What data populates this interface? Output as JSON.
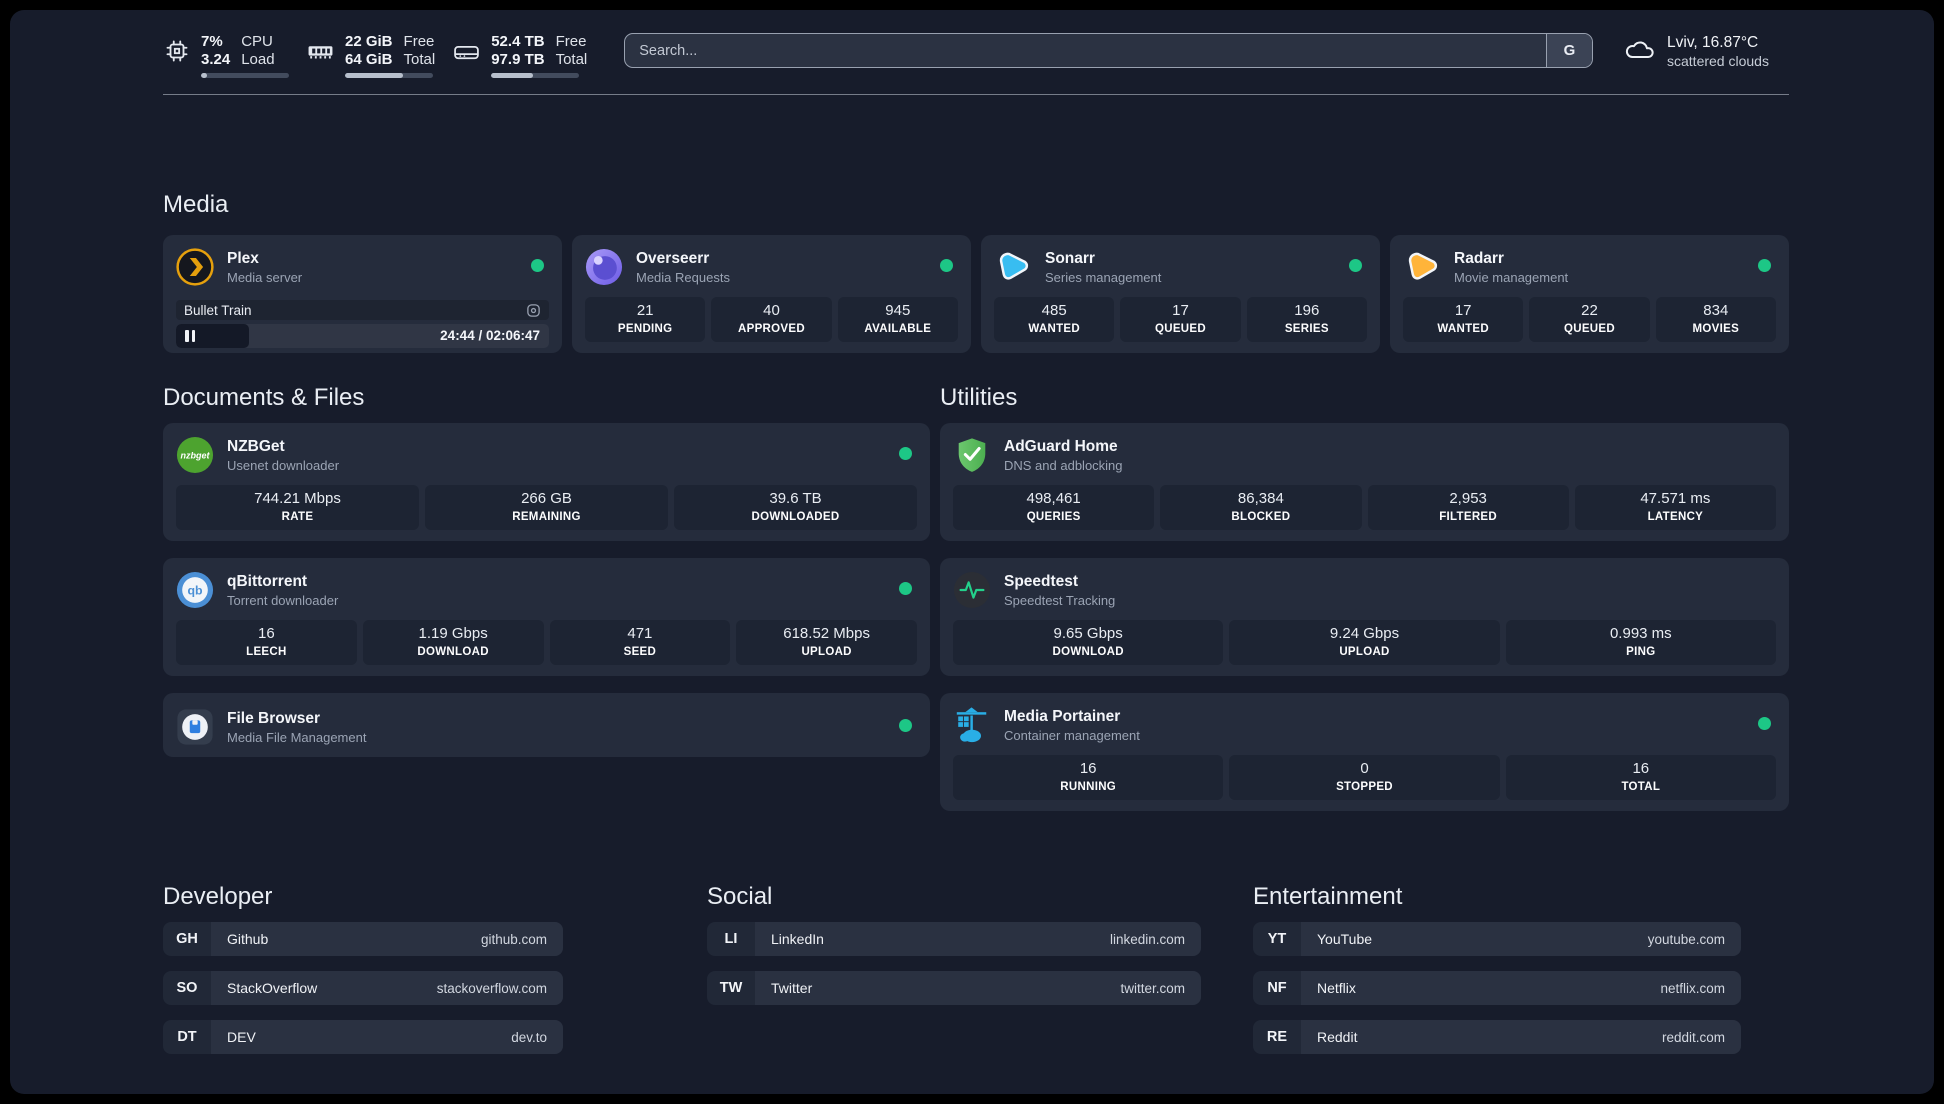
{
  "header": {
    "stats": [
      {
        "name": "cpu",
        "top_value": "7%",
        "bottom_value": "3.24",
        "top_label": "CPU",
        "bottom_label": "Load",
        "progress_pct": 7
      },
      {
        "name": "memory",
        "top_value": "22 GiB",
        "bottom_value": "64 GiB",
        "top_label": "Free",
        "bottom_label": "Total",
        "progress_pct": 66
      },
      {
        "name": "storage",
        "top_value": "52.4 TB",
        "bottom_value": "97.9 TB",
        "top_label": "Free",
        "bottom_label": "Total",
        "progress_pct": 47
      }
    ],
    "search_placeholder": "Search...",
    "search_provider": "G",
    "weather": {
      "location_temp": "Lviv, 16.87°C",
      "condition": "scattered clouds"
    }
  },
  "sections": {
    "media": {
      "title": "Media",
      "plex": {
        "name": "Plex",
        "description": "Media server",
        "online": true,
        "media_title": "Bullet Train",
        "media_time": "24:44 / 02:06:47",
        "progress_pct": 19.5
      },
      "overseerr": {
        "name": "Overseerr",
        "description": "Media Requests",
        "online": true,
        "stats": [
          {
            "value": "21",
            "label": "PENDING"
          },
          {
            "value": "40",
            "label": "APPROVED"
          },
          {
            "value": "945",
            "label": "AVAILABLE"
          }
        ]
      },
      "sonarr": {
        "name": "Sonarr",
        "description": "Series management",
        "online": true,
        "stats": [
          {
            "value": "485",
            "label": "WANTED"
          },
          {
            "value": "17",
            "label": "QUEUED"
          },
          {
            "value": "196",
            "label": "SERIES"
          }
        ]
      },
      "radarr": {
        "name": "Radarr",
        "description": "Movie management",
        "online": true,
        "stats": [
          {
            "value": "17",
            "label": "WANTED"
          },
          {
            "value": "22",
            "label": "QUEUED"
          },
          {
            "value": "834",
            "label": "MOVIES"
          }
        ]
      }
    },
    "documents": {
      "title": "Documents & Files",
      "nzbget": {
        "name": "NZBGet",
        "description": "Usenet downloader",
        "online": true,
        "stats": [
          {
            "value": "744.21 Mbps",
            "label": "RATE"
          },
          {
            "value": "266 GB",
            "label": "REMAINING"
          },
          {
            "value": "39.6 TB",
            "label": "DOWNLOADED"
          }
        ]
      },
      "qbittorrent": {
        "name": "qBittorrent",
        "description": "Torrent downloader",
        "online": true,
        "stats": [
          {
            "value": "16",
            "label": "LEECH"
          },
          {
            "value": "1.19 Gbps",
            "label": "DOWNLOAD"
          },
          {
            "value": "471",
            "label": "SEED"
          },
          {
            "value": "618.52 Mbps",
            "label": "UPLOAD"
          }
        ]
      },
      "filebrowser": {
        "name": "File Browser",
        "description": "Media File Management",
        "online": true
      }
    },
    "utilities": {
      "title": "Utilities",
      "adguard": {
        "name": "AdGuard Home",
        "description": "DNS and adblocking",
        "stats": [
          {
            "value": "498,461",
            "label": "QUERIES"
          },
          {
            "value": "86,384",
            "label": "BLOCKED"
          },
          {
            "value": "2,953",
            "label": "FILTERED"
          },
          {
            "value": "47.571 ms",
            "label": "LATENCY"
          }
        ]
      },
      "speedtest": {
        "name": "Speedtest",
        "description": "Speedtest Tracking",
        "stats": [
          {
            "value": "9.65 Gbps",
            "label": "DOWNLOAD"
          },
          {
            "value": "9.24 Gbps",
            "label": "UPLOAD"
          },
          {
            "value": "0.993 ms",
            "label": "PING"
          }
        ]
      },
      "portainer": {
        "name": "Media Portainer",
        "description": "Container management",
        "online": true,
        "stats": [
          {
            "value": "16",
            "label": "RUNNING"
          },
          {
            "value": "0",
            "label": "STOPPED"
          },
          {
            "value": "16",
            "label": "TOTAL"
          }
        ]
      }
    },
    "bookmarks": [
      {
        "title": "Developer",
        "links": [
          {
            "tag": "GH",
            "name": "Github",
            "url": "github.com"
          },
          {
            "tag": "SO",
            "name": "StackOverflow",
            "url": "stackoverflow.com"
          },
          {
            "tag": "DT",
            "name": "DEV",
            "url": "dev.to"
          }
        ]
      },
      {
        "title": "Social",
        "links": [
          {
            "tag": "LI",
            "name": "LinkedIn",
            "url": "linkedin.com"
          },
          {
            "tag": "TW",
            "name": "Twitter",
            "url": "twitter.com"
          }
        ]
      },
      {
        "title": "Entertainment",
        "links": [
          {
            "tag": "YT",
            "name": "YouTube",
            "url": "youtube.com"
          },
          {
            "tag": "NF",
            "name": "Netflix",
            "url": "netflix.com"
          },
          {
            "tag": "RE",
            "name": "Reddit",
            "url": "reddit.com"
          }
        ]
      }
    ]
  },
  "icons": {
    "header": [
      "cpu-icon",
      "memory-icon",
      "disk-icon",
      "cloud-icon"
    ],
    "apps": [
      "plex-icon",
      "overseerr-icon",
      "sonarr-icon",
      "radarr-icon",
      "nzbget-icon",
      "qbittorrent-icon",
      "filebrowser-icon",
      "adguard-icon",
      "speedtest-icon",
      "portainer-icon"
    ],
    "controls": [
      "pause-icon",
      "settings-icon",
      "search-provider-g"
    ]
  },
  "colors": {
    "background": "#171c2b",
    "card": "#252c3c",
    "stat_box": "#1d2433",
    "status_online_green": "#1dc786",
    "plex_amber": "#e5a00d",
    "sonarr_blue": "#38bdf1",
    "radarr_amber": "#ffb43a",
    "adguard_green": "#5ab95d",
    "portainer_blue": "#29aee6"
  }
}
